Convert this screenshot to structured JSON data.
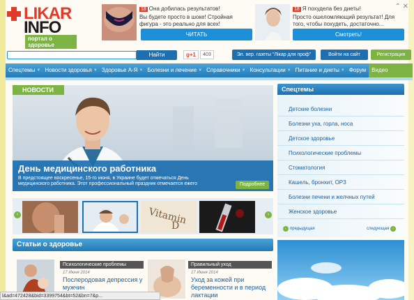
{
  "logo": {
    "word1": "LIKAR",
    "word2": "INFO",
    "tagline": "портал о здоровье"
  },
  "ads": [
    {
      "title": "Она добилась результатов!",
      "text": "Вы будете просто в шоке! Стройная фигура - это реально для всех!",
      "button": "ЧИТАТЬ",
      "badge": "18"
    },
    {
      "title": "Я похудела без диеты!",
      "text": "Просто ошеломляющий результат! Для того, чтобы похудеть, достаточно...",
      "button": "Смотреть!",
      "badge": "18"
    }
  ],
  "top_controls": "⌃ ✕",
  "search": {
    "value": "",
    "button": "Найти"
  },
  "social": {
    "gplus": "g+1",
    "count": "403"
  },
  "header_buttons": {
    "newspaper": "Эл. вер. газеты \"Лікар для проф\"",
    "login": "Войти на сайт",
    "register": "Регистрация"
  },
  "nav": {
    "items": [
      "Спецтемы",
      "Новости здоровья",
      "Здоровье А-Я",
      "Болезни и лечение",
      "Справочники",
      "Консультации",
      "Питание и диеты"
    ],
    "forum": "Форум",
    "video": "Видео"
  },
  "hero": {
    "label": "НОВОСТИ",
    "title": "День медицинского работника",
    "text": "В предстоящее воскресенье, 15-го июня, в Украине будет отмечаться День медицинского работника. Этот профессиональный праздник отмечается ежего",
    "more": "Подробнее"
  },
  "thumbs": {
    "prev": "‹",
    "next": "›"
  },
  "articles": {
    "heading": "Статьи о здоровье",
    "items": [
      {
        "category": "Психологические проблемы",
        "date": "17 Июня 2014",
        "title": "Послеродовая депрессия у мужчин"
      },
      {
        "category": "Правильный уход",
        "date": "17 Июня 2014",
        "title": "Уход за кожей при беременности и в период лактации"
      }
    ]
  },
  "sidebar": {
    "heading": "Спецтемы",
    "items": [
      "Детские болезни",
      "Болезни уха, горла, носа",
      "Детское здоровье",
      "Психологические проблемы",
      "Стоматология",
      "Кашель, бронхит, ОРЗ",
      "Болезни печени и желчных путей",
      "Женское здоровье"
    ],
    "prev": "предыдущая",
    "next": "следующая"
  },
  "status_bar": "l&ad=472428&bid=3399754&bt=52&bn=7&p..."
}
